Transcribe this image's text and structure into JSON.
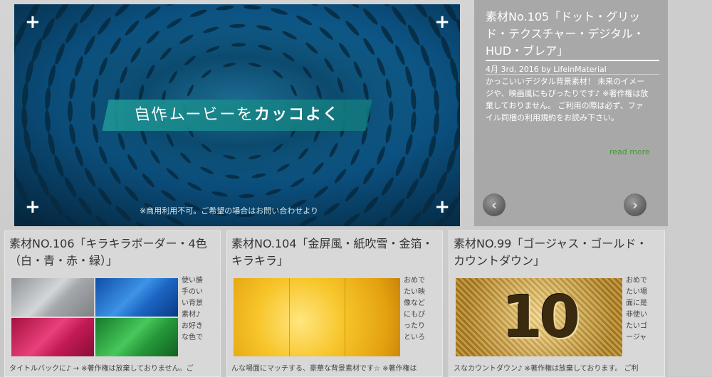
{
  "hero": {
    "tagline_pre": "自作ムービーを",
    "tagline_bold": "カッコよく",
    "note": "※商用利用不可。ご希望の場合はお問い合わせより"
  },
  "post": {
    "title": "素材No.105「ドット・グリッド・テクスチャー・デジタル・HUD・ブレア」",
    "meta": "4月 3rd, 2016 by LifeinMaterial",
    "body": "かっこいいデジタル背景素材！ 未来のイメージや、映画風にもぴったりです♪ ※著作権は放棄しておりません。 ご利用の際は必ず、ファイル同梱の利用規約をお読み下さい。",
    "read_more": "read more"
  },
  "cards": [
    {
      "title": "素材NO.106「キラキラボーダー・4色（白・青・赤・緑）」",
      "side": "使い勝手のいい背景素材♪お好きな色で",
      "bottom": "タイトルバックに♪ → ※著作権は放棄しておりません。ご"
    },
    {
      "title": "素材NO.104「金屏風・紙吹雪・金箔・キラキラ」",
      "side": "おめでたい映像などにもぴったりといろ",
      "bottom": "んな場面にマッチする、豪華な背景素材です☆ ※著作権は"
    },
    {
      "title": "素材NO.99「ゴージャス・ゴールド・カウントダウン」",
      "side": "おめでたい場面に是非使いたいゴージャ",
      "bottom": "スなカウントダウン♪ ※著作権は放棄しております。 ご利",
      "thumb_number": "10"
    }
  ],
  "colors": {
    "post_bg": "#a8a8a8",
    "read_more": "#3f9a2c",
    "tagline_bg": "#1e9696"
  }
}
